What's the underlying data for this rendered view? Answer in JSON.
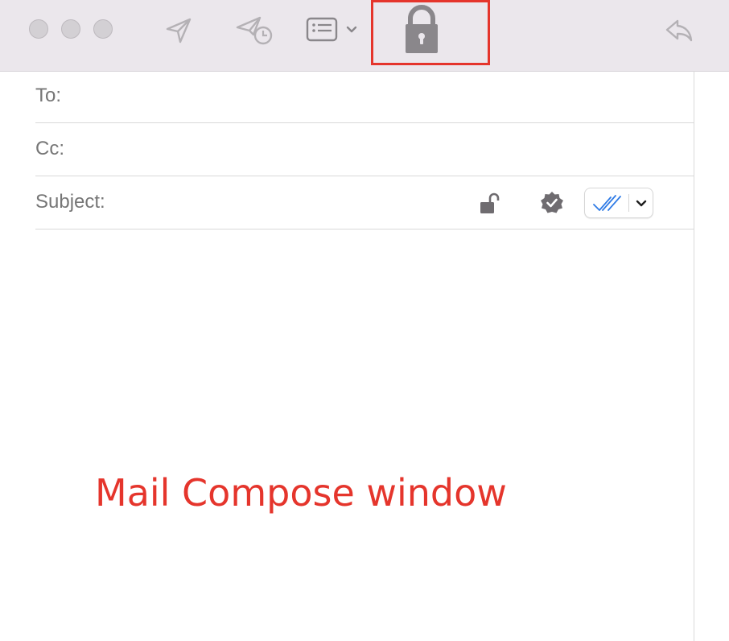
{
  "fields": {
    "to_label": "To:",
    "cc_label": "Cc:",
    "subject_label": "Subject:"
  },
  "annotation": {
    "text": "Mail Compose window",
    "color": "#e5352c"
  },
  "colors": {
    "toolbar_bg": "#ebe7ec",
    "icon_gray": "#8a878b",
    "icon_light": "#b4b1b5",
    "highlight": "#e5352c",
    "signature_check": "#2f7be6"
  },
  "icons": {
    "traffic_lights": [
      "close-button",
      "minimize-button",
      "zoom-button"
    ],
    "toolbar": [
      "send-icon",
      "send-later-icon",
      "header-fields-icon",
      "chevron-down-icon",
      "lock-icon",
      "reply-icon"
    ],
    "subject_row": [
      "unlock-icon",
      "verified-badge-icon",
      "signature-check-icon",
      "chevron-down-icon"
    ]
  }
}
